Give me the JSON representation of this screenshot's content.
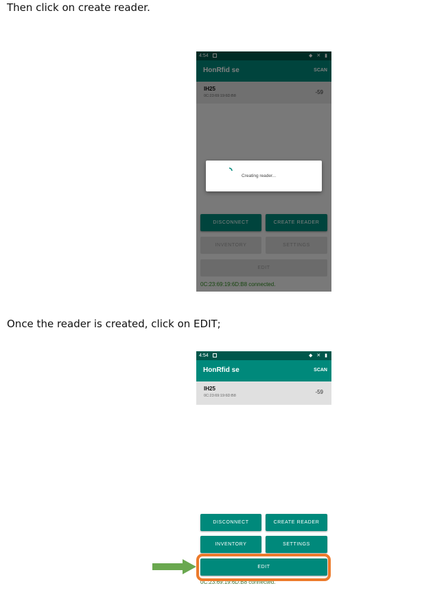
{
  "instructions": {
    "step1": "Then click on create reader.",
    "step2": "Once the reader is created, click on EDIT;"
  },
  "phone1": {
    "status_time": "4:54",
    "status_icons": "◆ ✕ ▮",
    "app_title": "HonRfid se",
    "scan_label": "SCAN",
    "device": {
      "name": "IH25",
      "mac": "0C:23:69:19:6D:B8",
      "rssi": "-59"
    },
    "dialog_message": "Creating reader...",
    "buttons": {
      "disconnect": "DISCONNECT",
      "create_reader": "CREATE READER",
      "inventory": "INVENTORY",
      "settings": "SETTINGS",
      "edit": "EDIT"
    },
    "status_text": "0C:23:69:19:6D:B8 connected."
  },
  "phone2": {
    "status_time": "4:54",
    "status_icons": "◆ ✕ ▮",
    "app_title": "HonRfid se",
    "scan_label": "SCAN",
    "device": {
      "name": "IH25",
      "mac": "0C:23:69:19:6D:B8",
      "rssi": "-59"
    },
    "buttons": {
      "disconnect": "DISCONNECT",
      "create_reader": "CREATE READER",
      "inventory": "INVENTORY",
      "settings": "SETTINGS",
      "edit": "EDIT"
    },
    "status_text": "0C:23:69:19:6D:B8 connected."
  },
  "colors": {
    "primary": "#00897b",
    "primary_dark": "#00574b",
    "highlight": "#ec7a2b",
    "arrow": "#6aa84f",
    "status_green": "#2e8b1e"
  }
}
